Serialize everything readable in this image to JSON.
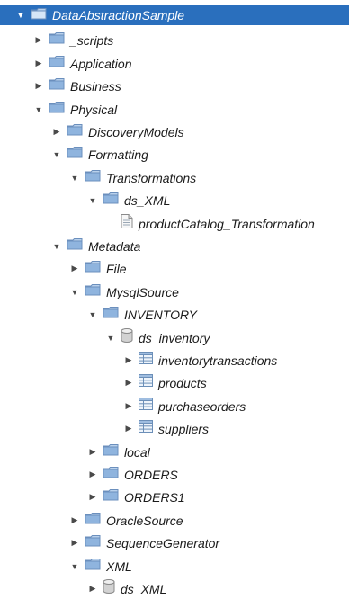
{
  "tree": {
    "nodes": [
      {
        "label": "DataAbstractionSample",
        "state": "expanded",
        "icon": "folder-icon",
        "depth": 0,
        "selected": true
      },
      {
        "label": "_scripts",
        "state": "collapsed",
        "icon": "folder-icon",
        "depth": 1
      },
      {
        "label": "Application",
        "state": "collapsed",
        "icon": "folder-icon",
        "depth": 1
      },
      {
        "label": "Business",
        "state": "collapsed",
        "icon": "folder-icon",
        "depth": 1
      },
      {
        "label": "Physical",
        "state": "expanded",
        "icon": "folder-icon",
        "depth": 1
      },
      {
        "label": "DiscoveryModels",
        "state": "collapsed",
        "icon": "folder-icon",
        "depth": 2
      },
      {
        "label": "Formatting",
        "state": "expanded",
        "icon": "folder-icon",
        "depth": 2
      },
      {
        "label": "Transformations",
        "state": "expanded",
        "icon": "folder-icon",
        "depth": 3
      },
      {
        "label": "ds_XML",
        "state": "expanded",
        "icon": "folder-icon",
        "depth": 4
      },
      {
        "label": "productCatalog_Transformation",
        "state": "leaf",
        "icon": "document-icon",
        "depth": 5
      },
      {
        "label": "Metadata",
        "state": "expanded",
        "icon": "folder-icon",
        "depth": 2
      },
      {
        "label": "File",
        "state": "collapsed",
        "icon": "folder-icon",
        "depth": 3
      },
      {
        "label": "MysqlSource",
        "state": "expanded",
        "icon": "folder-icon",
        "depth": 3
      },
      {
        "label": "INVENTORY",
        "state": "expanded",
        "icon": "folder-icon",
        "depth": 4
      },
      {
        "label": "ds_inventory",
        "state": "expanded",
        "icon": "database-icon",
        "depth": 5
      },
      {
        "label": "inventorytransactions",
        "state": "collapsed",
        "icon": "table-icon",
        "depth": 6
      },
      {
        "label": "products",
        "state": "collapsed",
        "icon": "table-icon",
        "depth": 6
      },
      {
        "label": "purchaseorders",
        "state": "collapsed",
        "icon": "table-icon",
        "depth": 6
      },
      {
        "label": "suppliers",
        "state": "collapsed",
        "icon": "table-icon",
        "depth": 6
      },
      {
        "label": "local",
        "state": "collapsed",
        "icon": "folder-icon",
        "depth": 4
      },
      {
        "label": "ORDERS",
        "state": "collapsed",
        "icon": "folder-icon",
        "depth": 4
      },
      {
        "label": "ORDERS1",
        "state": "collapsed",
        "icon": "folder-icon",
        "depth": 4
      },
      {
        "label": "OracleSource",
        "state": "collapsed",
        "icon": "folder-icon",
        "depth": 3
      },
      {
        "label": "SequenceGenerator",
        "state": "collapsed",
        "icon": "folder-icon",
        "depth": 3
      },
      {
        "label": "XML",
        "state": "expanded",
        "icon": "folder-icon",
        "depth": 3
      },
      {
        "label": "ds_XML",
        "state": "collapsed",
        "icon": "database-icon",
        "depth": 4
      }
    ]
  },
  "colors": {
    "selection": "#2a6fbd",
    "folder": "#8fb4de",
    "text": "#1b1b1b"
  }
}
